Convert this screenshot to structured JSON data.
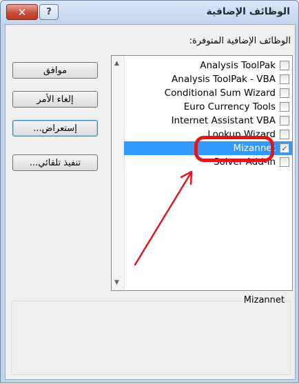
{
  "window": {
    "title": "الوظائف الإضافية",
    "close_glyph": "✕",
    "help_glyph": "?"
  },
  "addins": {
    "list_label": "الوظائف الإضافية المتوفرة:",
    "items": [
      {
        "label": "Analysis ToolPak",
        "checked": false
      },
      {
        "label": "Analysis ToolPak - VBA",
        "checked": false
      },
      {
        "label": "Conditional Sum Wizard",
        "checked": false
      },
      {
        "label": "Euro Currency Tools",
        "checked": false
      },
      {
        "label": "Internet Assistant VBA",
        "checked": false
      },
      {
        "label": "Lookup Wizard",
        "checked": false
      },
      {
        "label": "Mizannet",
        "checked": true,
        "selected": true
      },
      {
        "label": "Solver Add-in",
        "checked": false
      }
    ],
    "check_glyph": "✓"
  },
  "buttons": {
    "ok": "موافق",
    "cancel": "إلغاء الأمر",
    "browse": "إستعراض...",
    "automation": "تنفيذ تلقائي..."
  },
  "description": {
    "title": "Mizannet",
    "text": ""
  },
  "annotation": {
    "ring_color": "#e0161a",
    "arrow_color": "#e0161a"
  }
}
